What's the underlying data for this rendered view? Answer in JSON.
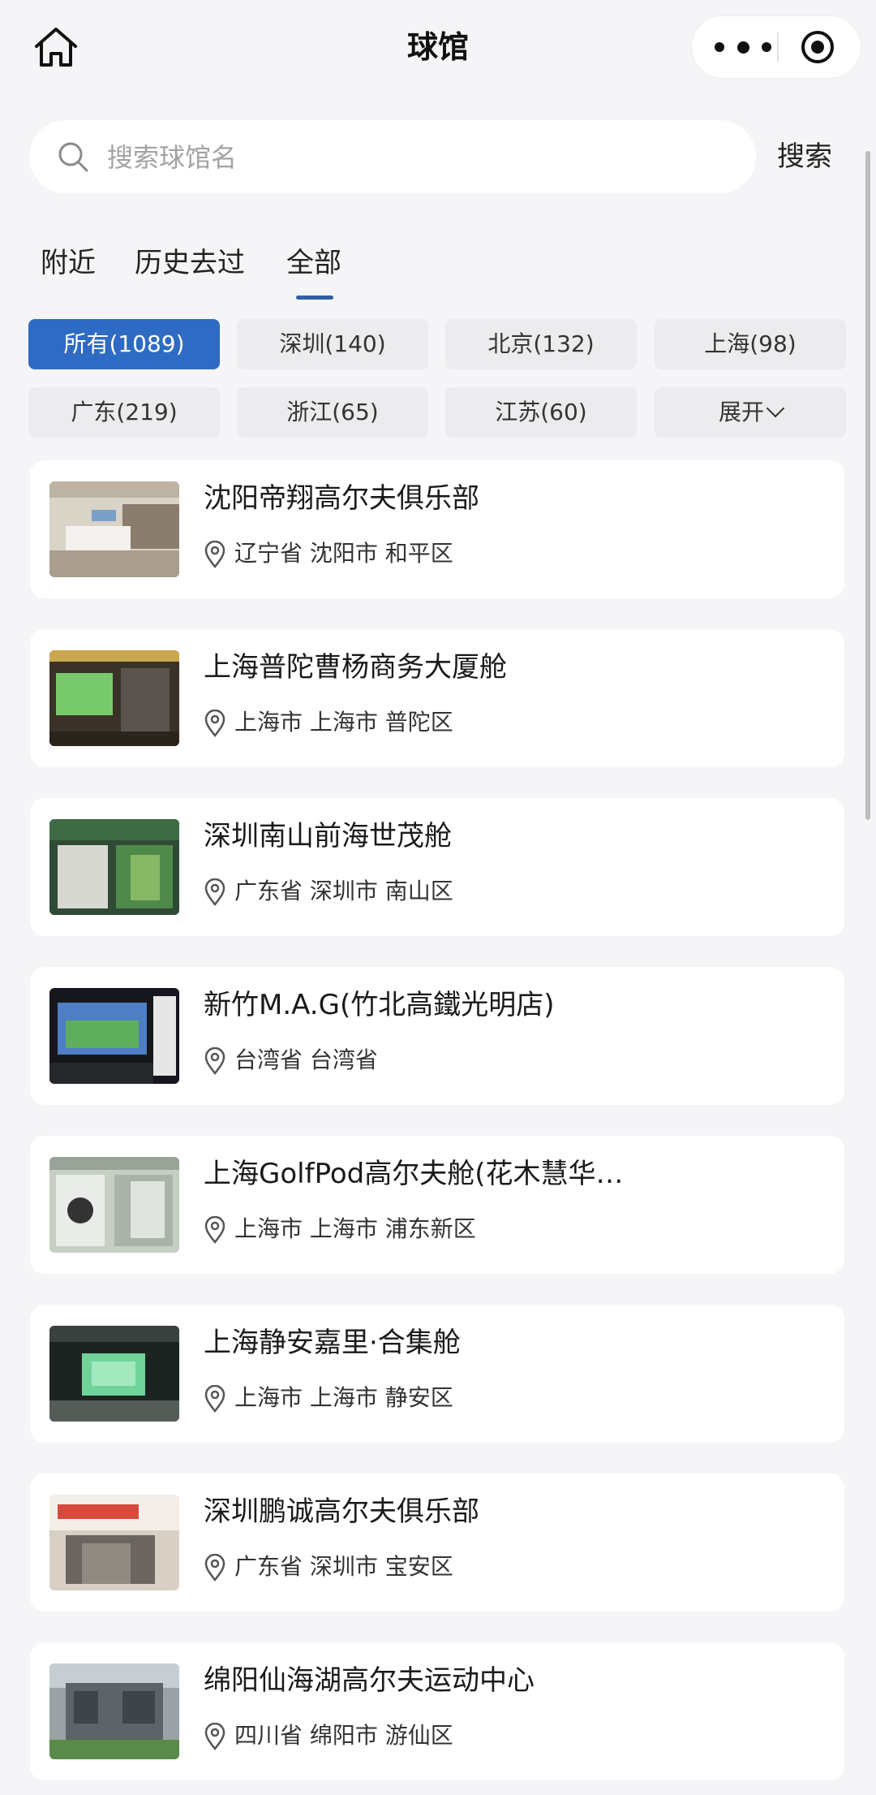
{
  "header": {
    "title": "球馆",
    "home_icon": "home-icon",
    "more_icon": "more-dots-icon",
    "close_icon": "target-close-icon"
  },
  "search": {
    "placeholder": "搜索球馆名",
    "value": "",
    "button_label": "搜索",
    "icon": "search-icon"
  },
  "tabs": [
    {
      "label": "附近",
      "active": false
    },
    {
      "label": "历史去过",
      "active": false
    },
    {
      "label": "全部",
      "active": true
    }
  ],
  "filters": [
    {
      "label": "所有(1089)",
      "active": true
    },
    {
      "label": "深圳(140)",
      "active": false
    },
    {
      "label": "北京(132)",
      "active": false
    },
    {
      "label": "上海(98)",
      "active": false
    },
    {
      "label": "广东(219)",
      "active": false
    },
    {
      "label": "浙江(65)",
      "active": false
    },
    {
      "label": "江苏(60)",
      "active": false
    },
    {
      "label": "展开",
      "active": false
    }
  ],
  "venues": [
    {
      "name": "沈阳帝翔高尔夫俱乐部",
      "location": "辽宁省 沈阳市 和平区"
    },
    {
      "name": "上海普陀曹杨商务大厦舱",
      "location": "上海市 上海市 普陀区"
    },
    {
      "name": "深圳南山前海世茂舱",
      "location": "广东省 深圳市 南山区"
    },
    {
      "name": "新竹M.A.G(竹北高鐵光明店)",
      "location": "台湾省 台湾省"
    },
    {
      "name": "上海GolfPod高尔夫舱(花木慧华…",
      "location": "上海市 上海市 浦东新区"
    },
    {
      "name": "上海静安嘉里·合集舱",
      "location": "上海市 上海市 静安区"
    },
    {
      "name": "深圳鹏诚高尔夫俱乐部",
      "location": "广东省 深圳市 宝安区"
    },
    {
      "name": "绵阳仙海湖高尔夫运动中心",
      "location": "四川省 绵阳市 游仙区"
    }
  ],
  "colors": {
    "accent": "#2e6bc4",
    "tab_indicator": "#2e5fa8",
    "background": "#f5f5f7"
  }
}
